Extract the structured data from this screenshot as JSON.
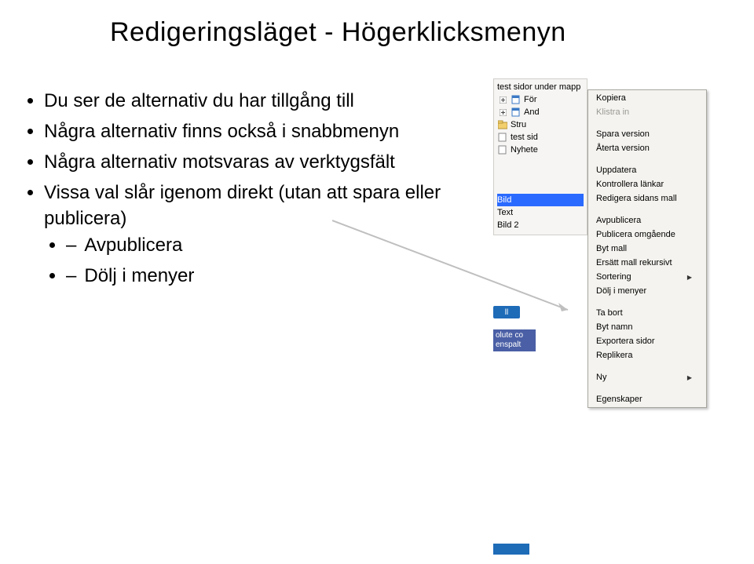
{
  "title": "Redigeringsläget - Högerklicksmenyn",
  "bullets": {
    "b1": "Du ser de alternativ du har tillgång till",
    "b2": "Några alternativ finns också i snabbmenyn",
    "b3": "Några alternativ motsvaras av verktygsfält",
    "b4": "Vissa val slår igenom direkt (utan att spara eller publicera)",
    "s1": "Avpublicera",
    "s2": "Dölj i menyer"
  },
  "tree": {
    "r0": "test sidor under mapp",
    "r1": "För",
    "r2": "And",
    "r3": "Stru",
    "r4": "test sid",
    "r5": "Nyhete",
    "r6": "olute co",
    "r7": "enspalt",
    "r8": "Bild",
    "r9": "Text",
    "r10": "Bild 2",
    "pill": "ll",
    "frag1": "olute co",
    "frag2": "enspalt"
  },
  "menu": {
    "m1": "Kopiera",
    "m2": "Klistra in",
    "m3": "Spara version",
    "m4": "Återta version",
    "m5": "Uppdatera",
    "m6": "Kontrollera länkar",
    "m7": "Redigera sidans mall",
    "m8": "Avpublicera",
    "m9": "Publicera omgående",
    "m10": "Byt mall",
    "m11": "Ersätt mall rekursivt",
    "m12": "Sortering",
    "m13": "Dölj i menyer",
    "m14": "Ta bort",
    "m15": "Byt namn",
    "m16": "Exportera sidor",
    "m17": "Replikera",
    "m18": "Ny",
    "m19": "Egenskaper"
  }
}
